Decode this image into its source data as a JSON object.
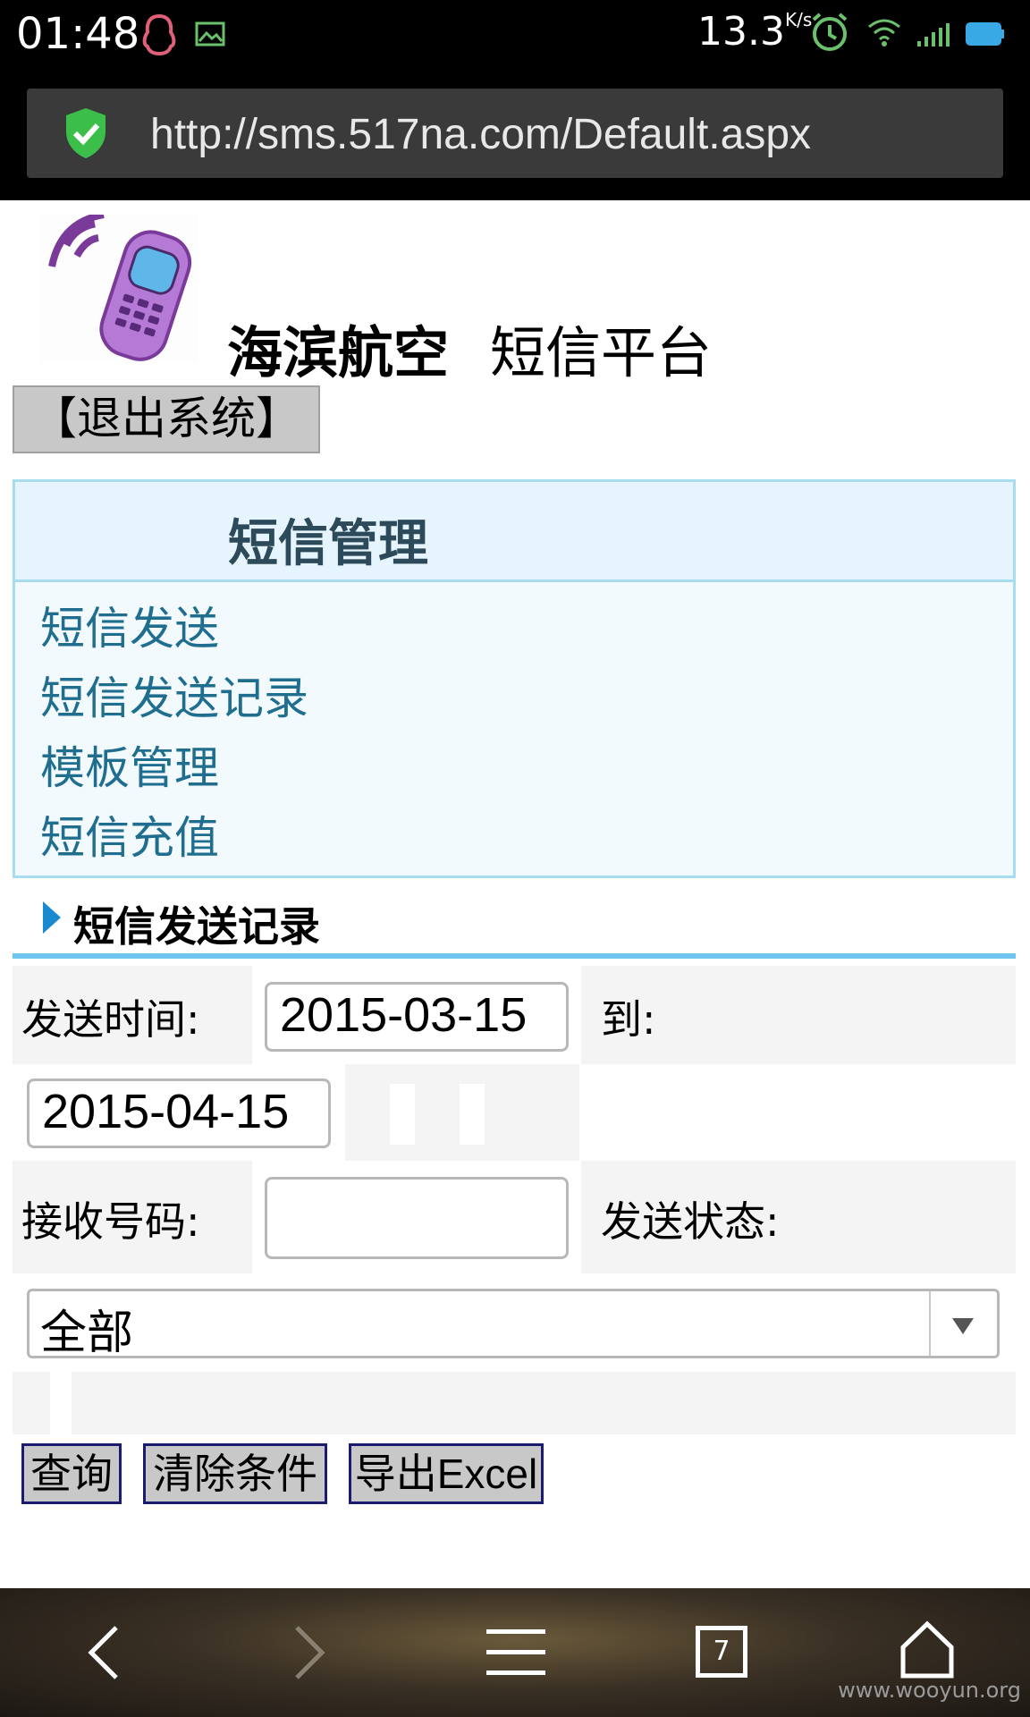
{
  "status_bar": {
    "time": "01:48",
    "speed": "13.3",
    "speed_unit": "K/s",
    "icons": [
      "qq-icon",
      "image-icon",
      "alarm-icon",
      "wifi-icon",
      "signal-icon",
      "battery-icon"
    ]
  },
  "browser": {
    "url": "http://sms.517na.com/Default.aspx",
    "security_icon": "shield-check-icon"
  },
  "header": {
    "brand": "海滨航空",
    "platform": "短信平台",
    "logout_label": "【退出系统】",
    "logo_icon": "mobile-phone-icon"
  },
  "menu": {
    "title": "短信管理",
    "items": [
      {
        "label": "短信发送"
      },
      {
        "label": "短信发送记录"
      },
      {
        "label": "模板管理"
      },
      {
        "label": "短信充值"
      }
    ]
  },
  "section": {
    "title": "短信发送记录"
  },
  "form": {
    "send_time_label": "发送时间:",
    "date_from": "2015-03-15",
    "to_label": "到:",
    "date_to": "2015-04-15",
    "phone_label": "接收号码:",
    "phone_value": "",
    "status_label": "发送状态:",
    "status_selected": "全部",
    "buttons": {
      "query": "查询",
      "clear": "清除条件",
      "export": "导出Excel"
    }
  },
  "nav": {
    "tab_count": "7",
    "icons": [
      "back-icon",
      "forward-icon",
      "menu-icon",
      "tabs-icon",
      "home-icon"
    ]
  },
  "watermark": "www.wooyun.org",
  "colors": {
    "menu_border": "#a8dcef",
    "link": "#1f6e90",
    "section_line": "#6ec6f0",
    "button_border": "#1c1c6e"
  }
}
